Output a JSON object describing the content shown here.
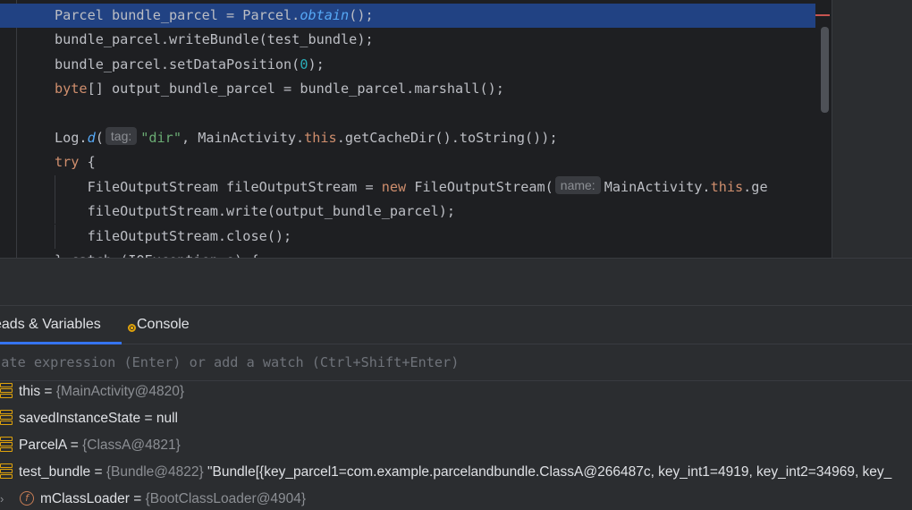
{
  "editor": {
    "lines": [
      {
        "tokens": [
          {
            "t": "Parcel bundle_parcel = Parcel."
          },
          {
            "t": "obtain",
            "c": "it"
          },
          {
            "t": "();"
          }
        ]
      },
      {
        "tokens": [
          {
            "t": "bundle_parcel.writeBundle(test_bundle);"
          }
        ]
      },
      {
        "tokens": [
          {
            "t": "bundle_parcel.setDataPosition("
          },
          {
            "t": "0",
            "c": "num"
          },
          {
            "t": ");"
          }
        ]
      },
      {
        "tokens": [
          {
            "t": "byte",
            "c": "kw"
          },
          {
            "t": "[] output_bundle_parcel = bundle_parcel.marshall();"
          }
        ]
      },
      {
        "tokens": []
      },
      {
        "tokens": [
          {
            "t": "Log."
          },
          {
            "t": "d",
            "c": "it"
          },
          {
            "t": "("
          },
          {
            "t": "tag:",
            "c": "hint"
          },
          {
            "t": "\"dir\"",
            "c": "str"
          },
          {
            "t": ", MainActivity."
          },
          {
            "t": "this",
            "c": "kw"
          },
          {
            "t": ".getCacheDir().toString());"
          }
        ]
      },
      {
        "tokens": [
          {
            "t": "try",
            "c": "kw"
          },
          {
            "t": " {"
          }
        ]
      },
      {
        "tokens": [
          {
            "t": "    FileOutputStream fileOutputStream = "
          },
          {
            "t": "new",
            "c": "kw"
          },
          {
            "t": " FileOutputStream("
          },
          {
            "t": "name:",
            "c": "hint"
          },
          {
            "t": "MainActivity."
          },
          {
            "t": "this",
            "c": "kw"
          },
          {
            "t": ".ge"
          }
        ]
      },
      {
        "tokens": [
          {
            "t": "    fileOutputStream.write(output_bundle_parcel);"
          }
        ]
      },
      {
        "tokens": [
          {
            "t": "    fileOutputStream.close();"
          }
        ]
      },
      {
        "tokens": [
          {
            "t": "} catch (IOException e) {"
          }
        ]
      }
    ]
  },
  "tabs": {
    "threads_label": "eads & Variables",
    "console_label": "Console"
  },
  "evaluate": {
    "placeholder": "luate expression (Enter) or add a watch (Ctrl+Shift+Enter)"
  },
  "variables": [
    {
      "name": "this",
      "eq": " = ",
      "ref": "{MainActivity@4820}",
      "value": ""
    },
    {
      "name": "savedInstanceState",
      "eq": " = ",
      "ref": "",
      "value": "null"
    },
    {
      "name": "ParcelA",
      "eq": " = ",
      "ref": "{ClassA@4821}",
      "value": ""
    },
    {
      "name": "test_bundle",
      "eq": " = ",
      "ref": "{Bundle@4822}",
      "value": " \"Bundle[{key_parcel1=com.example.parcelandbundle.ClassA@266487c, key_int1=4919, key_int2=34969, key_"
    },
    {
      "name": "mClassLoader",
      "eq": " = ",
      "ref": "{BootClassLoader@4904}",
      "value": ""
    }
  ],
  "icons": {
    "variable": "variable-stack-icon",
    "field": "field-icon",
    "field_letter": "f",
    "expand": "chevron-right-icon",
    "expand_glyph": "›"
  }
}
